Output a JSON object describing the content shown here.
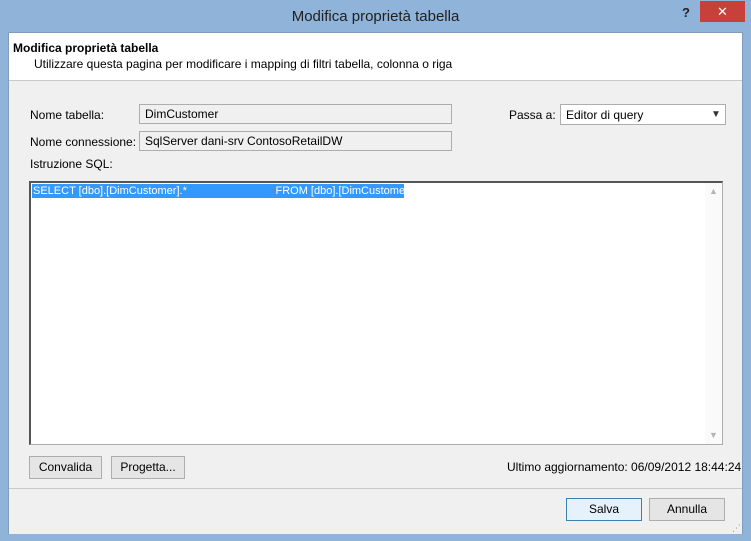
{
  "window": {
    "title": "Modifica proprietà tabella",
    "help_label": "?",
    "close_label": "✕"
  },
  "header": {
    "title": "Modifica proprietà tabella",
    "subtitle": "Utilizzare questa pagina per modificare i mapping di filtri tabella, colonna o riga"
  },
  "form": {
    "table_name_label": "Nome tabella:",
    "table_name_value": "DimCustomer",
    "connection_name_label": "Nome connessione:",
    "connection_name_value": "SqlServer dani-srv ContosoRetailDW",
    "switch_to_label": "Passa a:",
    "switch_to_value": "Editor di query",
    "sql_label": "Istruzione SQL:",
    "sql_text": "SELECT [dbo].[DimCustomer].*                             FROM [dbo].[DimCustomer]"
  },
  "actions": {
    "validate_label": "Convalida",
    "design_label": "Progetta...",
    "save_label": "Salva",
    "cancel_label": "Annulla"
  },
  "status": {
    "last_updated": "Ultimo aggiornamento: 06/09/2012 18:44:24"
  },
  "colors": {
    "title_bar": "#8fb3d9",
    "close_button": "#c7403a",
    "selection": "#3399ff"
  }
}
